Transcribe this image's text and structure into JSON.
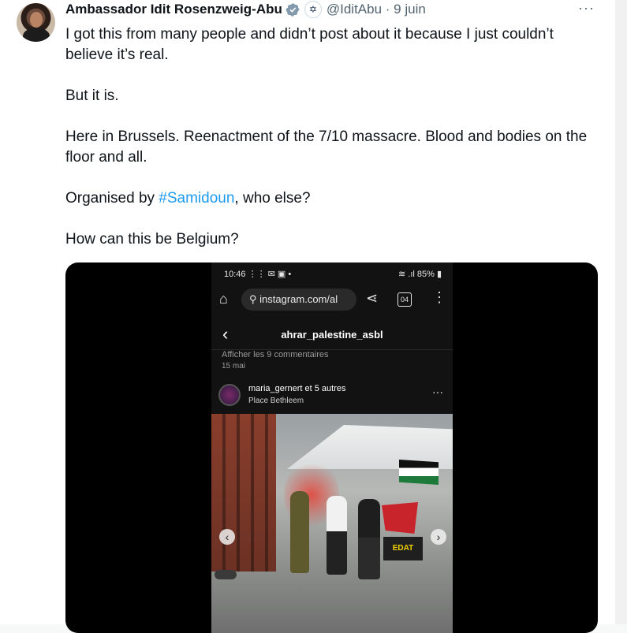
{
  "tweet": {
    "author_name": "Ambassador Idit Rosenzweig-Abu",
    "handle_date": "@IditAbu · 9 juin",
    "more_label": "···",
    "paragraphs": [
      "I got this from many people and didn’t post about  it because I just couldn’t believe it’s real.",
      "But it is.",
      "Here in Brussels. Reenactment of the 7/10 massacre. Blood and bodies on the floor and all."
    ],
    "p4_before": "Organised by ",
    "p4_hashtag": "#Samidoun",
    "p4_after": ", who else?",
    "p5": "How can this be Belgium?"
  },
  "icons": {
    "verified": "verified-badge-icon",
    "affiliation": "affiliation-badge-icon",
    "more": "more-icon"
  },
  "media": {
    "status_time": "10:46 ⋮⋮ ✉ ▣ •",
    "status_right": "≋ .ıl 85% ▮",
    "url": "instagram.com/al",
    "tabs_count": "04",
    "ig_username": "ahrar_palestine_asbl",
    "comments_link": "Afficher les 9 commentaires",
    "post_date": "15 mai",
    "post_user": "maria_gernert et 5 autres",
    "post_location": "Place Bethleem",
    "banner_text": "EDAT"
  },
  "colors": {
    "accent": "#1d9bf0",
    "verified": "#829aab"
  }
}
